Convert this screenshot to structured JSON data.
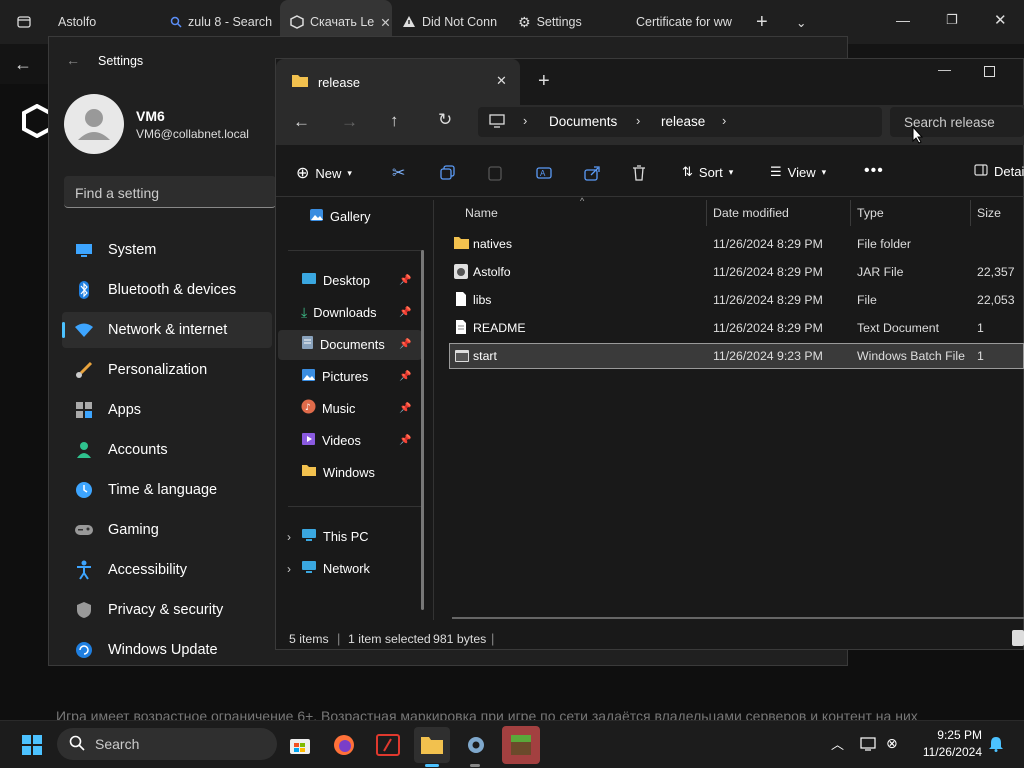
{
  "browser": {
    "tabs": [
      "Astolfo",
      "zulu 8 - Search",
      "Скачать Le",
      "Did Not Conn",
      "Settings",
      "Certificate for ww"
    ],
    "page_text": "Игра имеет возрастное ограничение 6+. Возрастная маркировка при игре по сети задаётся владельцами серверов и контент на них"
  },
  "settings": {
    "title": "Settings",
    "user_name": "VM6",
    "user_email": "VM6@collabnet.local",
    "search_placeholder": "Find a setting",
    "nav": [
      "System",
      "Bluetooth & devices",
      "Network & internet",
      "Personalization",
      "Apps",
      "Accounts",
      "Time & language",
      "Gaming",
      "Accessibility",
      "Privacy & security",
      "Windows Update"
    ],
    "selected_index": 2
  },
  "explorer": {
    "tab_title": "release",
    "breadcrumb": [
      "Documents",
      "release"
    ],
    "search_placeholder": "Search release",
    "toolbar": {
      "new": "New",
      "sort": "Sort",
      "view": "View",
      "details": "Details"
    },
    "sidebar": {
      "gallery": "Gallery",
      "quick": [
        "Desktop",
        "Downloads",
        "Documents",
        "Pictures",
        "Music",
        "Videos",
        "Windows"
      ],
      "this_pc": "This PC",
      "network": "Network"
    },
    "columns": {
      "name": "Name",
      "date": "Date modified",
      "type": "Type",
      "size": "Size"
    },
    "files": [
      {
        "name": "natives",
        "date": "11/26/2024 8:29 PM",
        "type": "File folder",
        "size": ""
      },
      {
        "name": "Astolfo",
        "date": "11/26/2024 8:29 PM",
        "type": "JAR File",
        "size": "22,357"
      },
      {
        "name": "libs",
        "date": "11/26/2024 8:29 PM",
        "type": "File",
        "size": "22,053"
      },
      {
        "name": "README",
        "date": "11/26/2024 8:29 PM",
        "type": "Text Document",
        "size": "1"
      },
      {
        "name": "start",
        "date": "11/26/2024 9:23 PM",
        "type": "Windows Batch File",
        "size": "1"
      }
    ],
    "selected_file": 4,
    "status": {
      "items": "5 items",
      "selected": "1 item selected",
      "bytes": "981 bytes"
    }
  },
  "taskbar": {
    "search": "Search",
    "time": "9:25 PM",
    "date": "11/26/2024"
  }
}
